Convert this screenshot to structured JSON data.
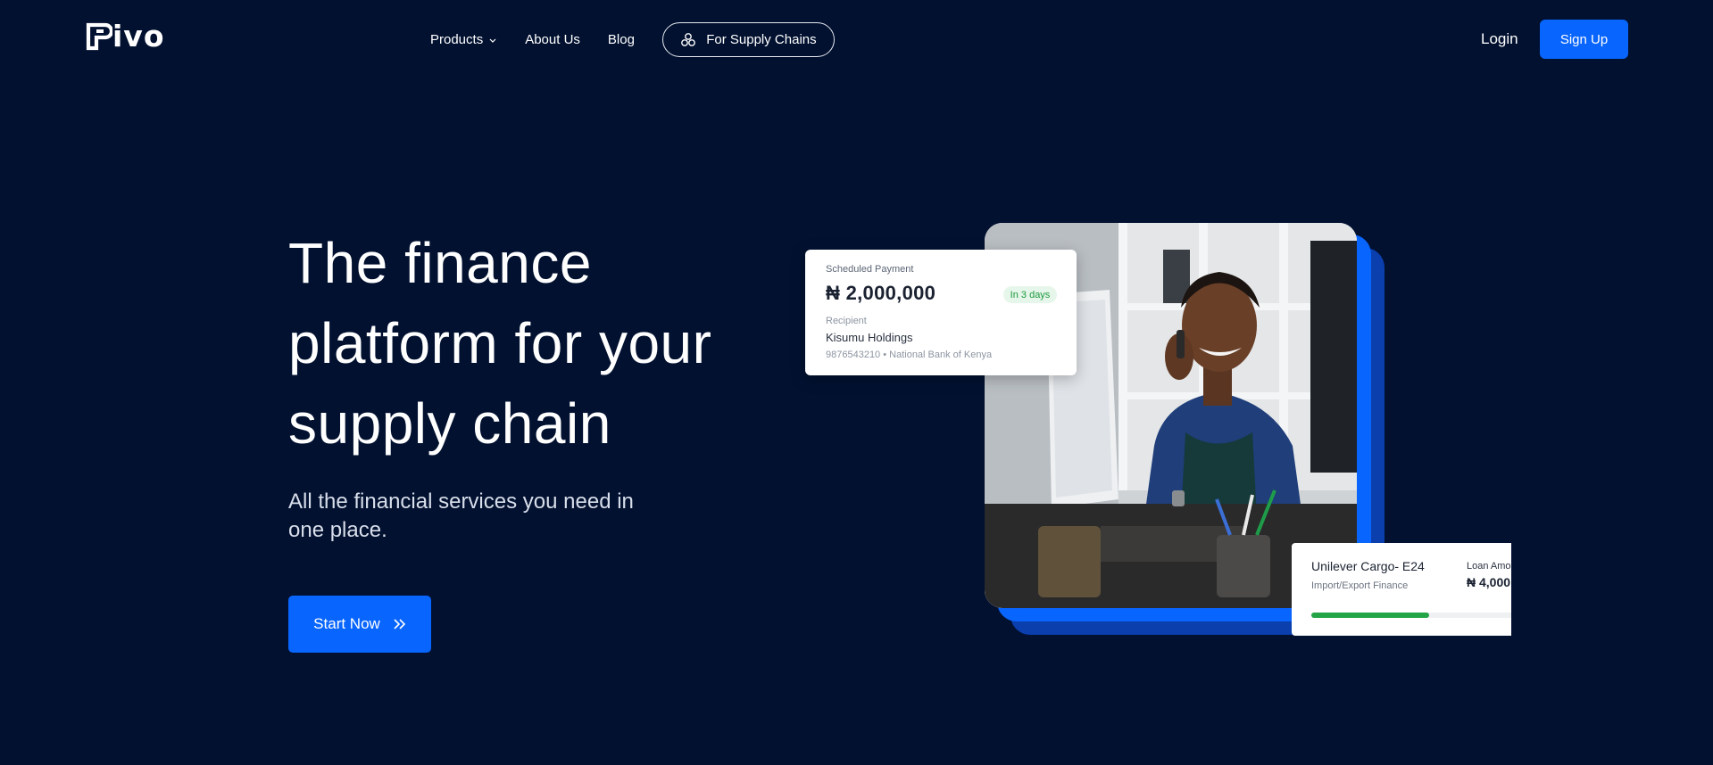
{
  "brand": {
    "logo_text": "ivo"
  },
  "nav": {
    "items": [
      {
        "label": "Products",
        "has_dropdown": true
      },
      {
        "label": "About Us"
      },
      {
        "label": "Blog"
      }
    ],
    "supply_button": "For Supply Chains",
    "login": "Login",
    "signup": "Sign Up"
  },
  "hero": {
    "title": "The finance platform for your supply chain",
    "subtitle": "All the financial services you need in one place.",
    "cta": "Start Now"
  },
  "payment_card": {
    "label": "Scheduled Payment",
    "amount": "₦ 2,000,000",
    "badge": "In 3 days",
    "recipient_label": "Recipient",
    "recipient_name": "Kisumu Holdings",
    "recipient_meta": "9876543210  •  National Bank of Kenya"
  },
  "loan_card": {
    "title": "Unilever Cargo- E24",
    "type": "Import/Export Finance",
    "amount_label": "Loan Amo",
    "amount": "₦ 4,000",
    "progress": 0.55
  },
  "colors": {
    "background": "#021130",
    "accent": "#0865fe",
    "accent_dark": "#0a3fad",
    "success": "#22a447"
  }
}
